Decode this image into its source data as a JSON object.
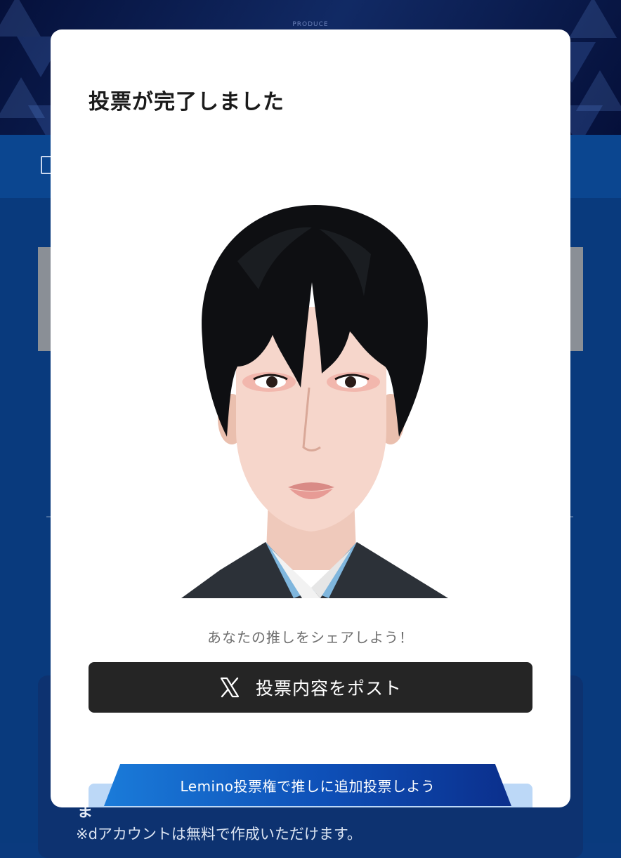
{
  "modal": {
    "title": "投票が完了しました",
    "share_prompt": "あなたの推しをシェアしよう！",
    "post_button_label": "投票内容をポスト",
    "post_button_icon": "x-logo-icon",
    "lemino_button_label": "Lemino投票権で推しに追加投票しよう"
  },
  "background": {
    "header_logo_text": "PRODUCE",
    "panel_heading_fragment": "ま",
    "note_text": "※dアカウントは無料で作成いただけます。"
  },
  "colors": {
    "page_bg": "#0a3a7e",
    "post_button_bg": "#252525",
    "lemino_gradient_start": "#1a7bd9",
    "lemino_gradient_end": "#0b2f8c"
  }
}
